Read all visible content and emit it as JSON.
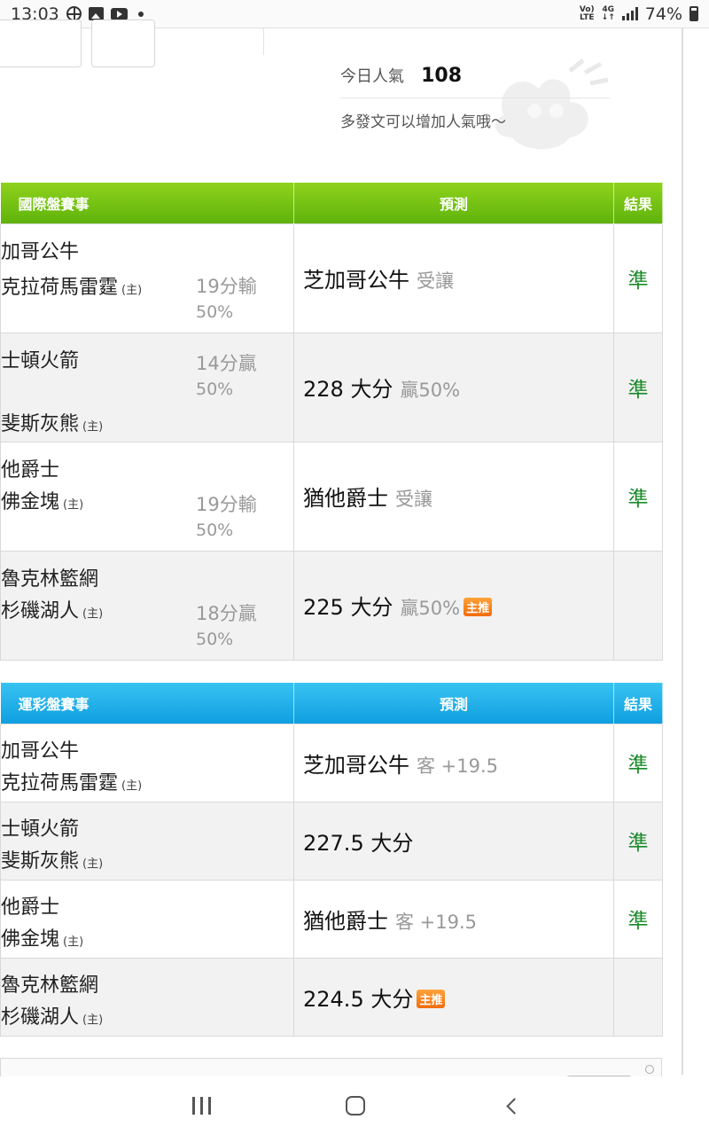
{
  "status_bar": {
    "time": "13:03",
    "network_top": "Vo)",
    "network_bottom": "LTE",
    "signal_type": "4G",
    "battery": "74%",
    "icons": [
      "basketball-icon",
      "image-icon",
      "youtube-icon",
      "dot-icon",
      "volte-icon",
      "4g-icon",
      "signal-icon",
      "battery-icon"
    ]
  },
  "popularity": {
    "label": "今日人氣",
    "value": "108",
    "tip": "多發文可以增加人氣哦～"
  },
  "intl_table": {
    "headers": {
      "match": "國際盤賽事",
      "prediction": "預測",
      "result": "結果"
    },
    "rows": [
      {
        "away": "加哥公牛",
        "home": "克拉荷馬雷霆",
        "home_mark": "(主)",
        "spread": "19分輸",
        "spread_pct": "50%",
        "pred_main": "芝加哥公牛",
        "pred_sub": "受讓",
        "hot": "",
        "result": "準"
      },
      {
        "away": "士頓火箭",
        "home": "斐斯灰熊",
        "home_mark": "(主)",
        "spread": "14分贏",
        "spread_pct": "50%",
        "pred_main": "228 大分",
        "pred_sub": "贏50%",
        "hot": "",
        "result": "準"
      },
      {
        "away": "他爵士",
        "home": "佛金塊",
        "home_mark": "(主)",
        "spread": "19分輸",
        "spread_pct": "50%",
        "pred_main": "猶他爵士",
        "pred_sub": "受讓",
        "hot": "",
        "result": "準"
      },
      {
        "away": "魯克林籃網",
        "home": "杉磯湖人",
        "home_mark": "(主)",
        "spread": "18分贏",
        "spread_pct": "50%",
        "pred_main": "225 大分",
        "pred_sub": "贏50%",
        "hot": "主推",
        "result": ""
      }
    ]
  },
  "sports_table": {
    "headers": {
      "match": "運彩盤賽事",
      "prediction": "預測",
      "result": "結果"
    },
    "rows": [
      {
        "away": "加哥公牛",
        "home": "克拉荷馬雷霆",
        "home_mark": "(主)",
        "pred_main": "芝加哥公牛",
        "pred_sub": "客 +19.5",
        "hot": "",
        "result": "準"
      },
      {
        "away": "士頓火箭",
        "home": "斐斯灰熊",
        "home_mark": "(主)",
        "pred_main": "227.5 大分",
        "pred_sub": "",
        "hot": "",
        "result": "準"
      },
      {
        "away": "他爵士",
        "home": "佛金塊",
        "home_mark": "(主)",
        "pred_main": "猶他爵士",
        "pred_sub": "客 +19.5",
        "hot": "",
        "result": "準"
      },
      {
        "away": "魯克林籃網",
        "home": "杉磯湖人",
        "home_mark": "(主)",
        "pred_main": "224.5 大分",
        "pred_sub": "",
        "hot": "主推",
        "result": ""
      }
    ]
  },
  "nav_bar": {
    "buttons": [
      "recents-button",
      "home-button",
      "back-button"
    ]
  },
  "colors": {
    "intl_header": "#6cbf12",
    "sports_header": "#1aaae6",
    "result_green": "#1a8a2a",
    "hot_badge": "#f58a1f"
  }
}
